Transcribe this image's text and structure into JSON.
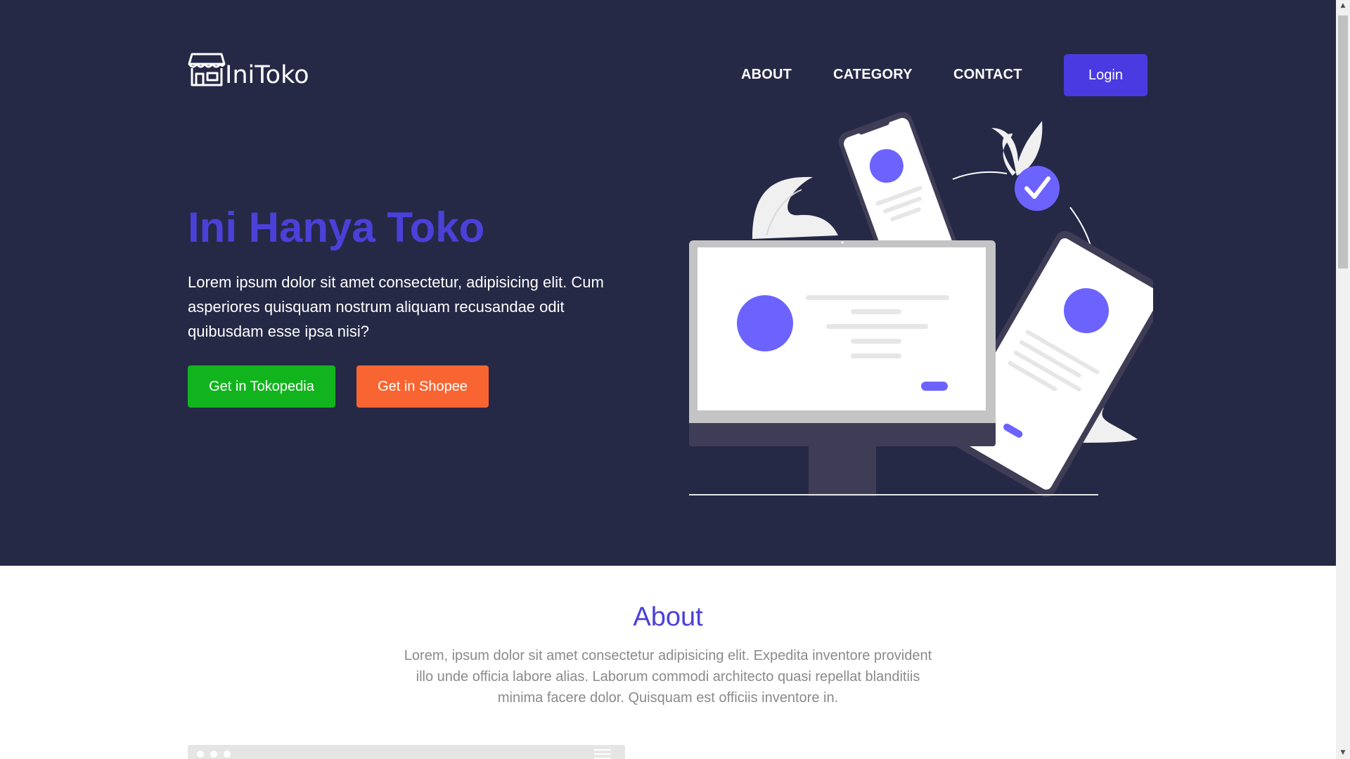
{
  "brand": {
    "name": "IniToko"
  },
  "nav": {
    "about": "ABOUT",
    "category": "CATEGORY",
    "contact": "CONTACT",
    "login": "Login"
  },
  "hero": {
    "title": "Ini Hanya Toko",
    "description": "Lorem ipsum dolor sit amet consectetur, adipisicing elit. Cum asperiores quisquam nostrum aliquam recusandae odit quibusdam esse ipsa nisi?",
    "buttons": {
      "tokopedia": "Get in Tokopedia",
      "shopee": "Get in Shopee"
    }
  },
  "about": {
    "title": "About",
    "description": "Lorem, ipsum dolor sit amet consectetur adipisicing elit. Expedita inventore provident illo unde officia labore alias. Laborum commodi architecto quasi repellat blanditiis minima facere dolor. Quisquam est officiis inventore in."
  },
  "colors": {
    "hero_background": "#252946",
    "accent": "#4b40d8",
    "login_button": "#4a3ae2",
    "tokopedia_green": "#12b41e",
    "shopee_orange": "#f86532",
    "illustration_accent": "#6c63ff"
  },
  "icons": {
    "logo": "store-icon",
    "illustration": "responsive-devices-illustration",
    "check": "check-circle-icon"
  }
}
